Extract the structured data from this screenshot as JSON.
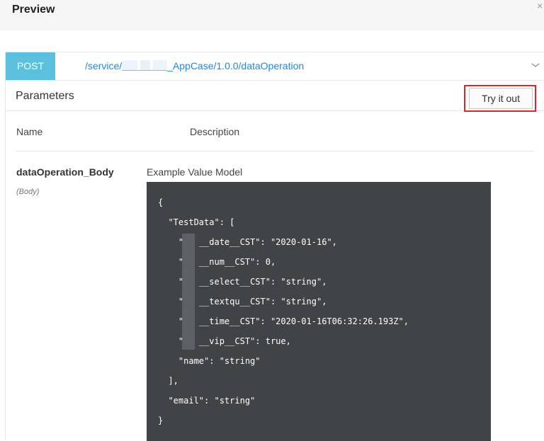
{
  "header": {
    "title": "Preview",
    "close_glyph": "×"
  },
  "operation": {
    "method": "POST",
    "path_prefix": "/service/",
    "path_suffix": "_AppCase/1.0.0/dataOperation"
  },
  "parameters": {
    "title": "Parameters",
    "try_button_label": "Try it out",
    "columns": {
      "name": "Name",
      "description": "Description"
    },
    "items": [
      {
        "name": "dataOperation_Body",
        "in": "(Body)",
        "example_label": "Example Value Model",
        "example_lines": [
          "{",
          "  \"TestData\": [",
          "    \"   __date__CST\": \"2020-01-16\",",
          "    \"   __num__CST\": 0,",
          "    \"   __select__CST\": \"string\",",
          "    \"   __textqu__CST\": \"string\",",
          "    \"   __time__CST\": \"2020-01-16T06:32:26.193Z\",",
          "    \"   __vip__CST\": true,",
          "    \"name\": \"string\"",
          "  ],",
          "  \"email\": \"string\"",
          "}"
        ]
      }
    ]
  },
  "colors": {
    "method_badge": "#5bc0de",
    "path_link": "#1e88e5",
    "highlight": "#e0242a",
    "code_bg": "#414446"
  }
}
